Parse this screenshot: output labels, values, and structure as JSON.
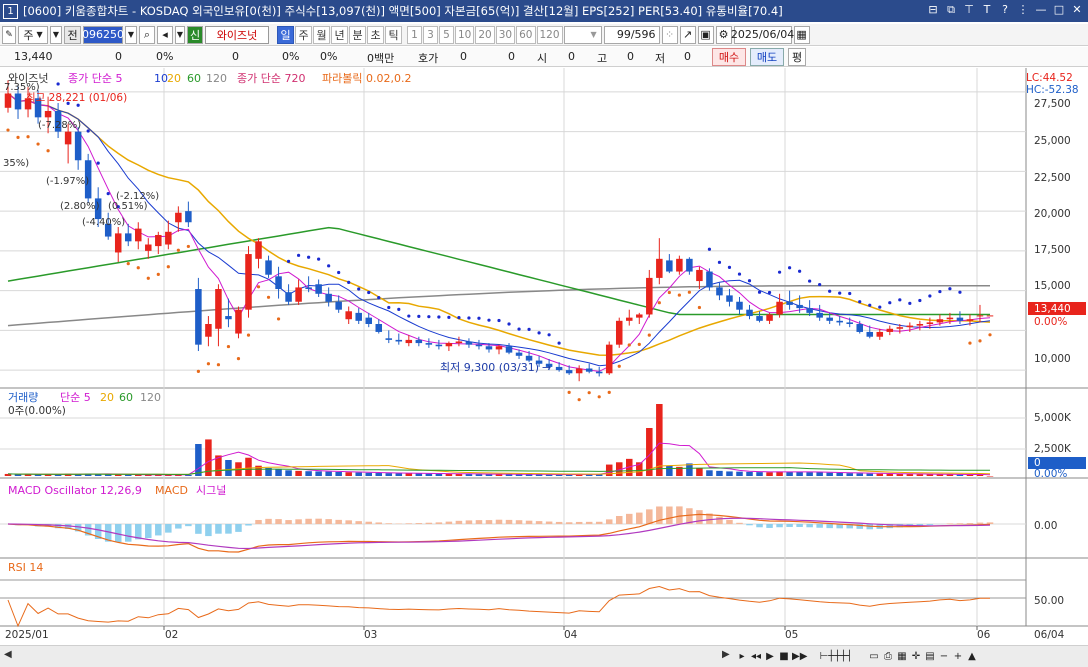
{
  "window": {
    "number": "1",
    "title": "[0600] 키움종합차트 - KOSDAQ 외국인보유[0(천)] 주식수[13,097(천)] 액면[500] 자본금[65(억)] 결산[12월] EPS[252] PER[53.40] 유통비율[70.4]"
  },
  "toolbar": {
    "market": "주",
    "all_label": "전",
    "code": "096250",
    "new_label": "신",
    "stock_name": "와이즈넛",
    "periods": [
      "일",
      "주",
      "월",
      "년",
      "분",
      "초",
      "틱"
    ],
    "active_period": "일",
    "intervals": [
      "1",
      "3",
      "5",
      "10",
      "20",
      "30",
      "60",
      "120"
    ],
    "count": "99/596",
    "date": "2025/06/04"
  },
  "quote": {
    "price": "13,440",
    "change": "0",
    "change_pct": "0%",
    "volume": "0",
    "volume_pct": "0%",
    "trade_amount": "0",
    "amount_pct": "0%",
    "amount_unit": "0백만",
    "bid_label": "호가",
    "bid": "0",
    "bid_qty": "0",
    "open_label": "시",
    "open": "0",
    "high_label": "고",
    "high": "0",
    "low_label": "저",
    "low": "0",
    "buy_label": "매수",
    "sell_label": "매도",
    "eval_label": "평"
  },
  "price_panel": {
    "legend_stock": "와이즈넛",
    "legend_ma": "종가 단순 5",
    "ma_periods": [
      "5",
      "10",
      "20",
      "60",
      "120"
    ],
    "legend_ma_long": "종가 단순 720",
    "legend_psar": "파라볼릭 0.02,0.2",
    "high_annotation": "최고 28,221 (01/06)",
    "low_annotation": "최저 9,300 (03/31)",
    "pct_labels": [
      "7.35%)",
      "(-7.28%)",
      "35%)",
      "(-1.97%)",
      "(-2.12%)",
      "(2.80%)",
      "(0.51%)",
      "(-4.40%)"
    ],
    "lc_label": "LC:44.52",
    "hc_label": "HC:-52.38",
    "y_ticks": [
      "27,500",
      "25,000",
      "22,500",
      "20,000",
      "17,500",
      "15,000",
      "10,000"
    ],
    "last_price": "13,440",
    "last_pct": "0.00%"
  },
  "volume_panel": {
    "legend": "거래량",
    "legend_ma": "단순 5",
    "ma_periods": [
      "5",
      "20",
      "60",
      "120"
    ],
    "info": "0주(0.00%)",
    "y_ticks": [
      "5,000K",
      "2,500K"
    ],
    "last": "0",
    "last_pct": "0.00%"
  },
  "macd_panel": {
    "legend": "MACD Oscillator 12,26,9",
    "legend_macd": "MACD",
    "legend_signal": "시그널",
    "y_tick": "0.00"
  },
  "rsi_panel": {
    "legend": "RSI 14",
    "y_tick": "50.00"
  },
  "x_axis": {
    "labels": [
      "2025/01",
      "02",
      "03",
      "04",
      "05",
      "06"
    ],
    "right_date": "06/04"
  },
  "colors": {
    "up": "#e8241c",
    "down": "#1e5ec8",
    "ma5": "#d01ad0",
    "ma10": "#1a3cd0",
    "ma20": "#e8a800",
    "ma60": "#2a9a2a",
    "ma120": "#888888",
    "psar_up": "#e86a1a",
    "psar_down": "#1a2ad0",
    "grid": "#d8d8d8",
    "panel_sep": "#888888"
  },
  "chart_data": {
    "type": "candlestick",
    "title": "",
    "x_labels": [
      "2025/01",
      "02",
      "03",
      "04",
      "05",
      "06"
    ],
    "price_ylim": [
      9000,
      28500
    ],
    "candles": [
      {
        "o": 26500,
        "h": 28221,
        "l": 26200,
        "c": 27400
      },
      {
        "o": 27400,
        "h": 27900,
        "l": 25800,
        "c": 26400
      },
      {
        "o": 26400,
        "h": 27800,
        "l": 25900,
        "c": 27100
      },
      {
        "o": 27100,
        "h": 27600,
        "l": 25500,
        "c": 25900
      },
      {
        "o": 25900,
        "h": 27200,
        "l": 24900,
        "c": 26300
      },
      {
        "o": 26300,
        "h": 26800,
        "l": 24600,
        "c": 25000
      },
      {
        "o": 24200,
        "h": 25500,
        "l": 23000,
        "c": 25000
      },
      {
        "o": 25000,
        "h": 25300,
        "l": 22600,
        "c": 23200
      },
      {
        "o": 23200,
        "h": 23600,
        "l": 20500,
        "c": 20800
      },
      {
        "o": 20800,
        "h": 21500,
        "l": 19000,
        "c": 19500
      },
      {
        "o": 19200,
        "h": 19900,
        "l": 18200,
        "c": 18400
      },
      {
        "o": 17400,
        "h": 19000,
        "l": 16800,
        "c": 18600
      },
      {
        "o": 18600,
        "h": 19200,
        "l": 17800,
        "c": 18100
      },
      {
        "o": 18100,
        "h": 19300,
        "l": 17600,
        "c": 18900
      },
      {
        "o": 17500,
        "h": 18300,
        "l": 17000,
        "c": 17900
      },
      {
        "o": 17800,
        "h": 18700,
        "l": 17300,
        "c": 18500
      },
      {
        "o": 17900,
        "h": 19400,
        "l": 17600,
        "c": 18700
      },
      {
        "o": 19300,
        "h": 20300,
        "l": 18700,
        "c": 19900
      },
      {
        "o": 20000,
        "h": 20600,
        "l": 19000,
        "c": 19300
      },
      {
        "o": 15100,
        "h": 15800,
        "l": 11200,
        "c": 11600
      },
      {
        "o": 12100,
        "h": 13400,
        "l": 11500,
        "c": 12900
      },
      {
        "o": 12600,
        "h": 15400,
        "l": 11500,
        "c": 15100
      },
      {
        "o": 13400,
        "h": 14500,
        "l": 12700,
        "c": 13200
      },
      {
        "o": 12300,
        "h": 14000,
        "l": 12000,
        "c": 13800
      },
      {
        "o": 13800,
        "h": 17800,
        "l": 13300,
        "c": 17300
      },
      {
        "o": 17000,
        "h": 18300,
        "l": 16400,
        "c": 18100
      },
      {
        "o": 16900,
        "h": 17200,
        "l": 15800,
        "c": 16000
      },
      {
        "o": 15900,
        "h": 16500,
        "l": 14500,
        "c": 15100
      },
      {
        "o": 14900,
        "h": 15400,
        "l": 14100,
        "c": 14300
      },
      {
        "o": 14300,
        "h": 15700,
        "l": 14100,
        "c": 15200
      },
      {
        "o": 15200,
        "h": 15900,
        "l": 14900,
        "c": 15100
      },
      {
        "o": 15400,
        "h": 15700,
        "l": 14600,
        "c": 14800
      },
      {
        "o": 14800,
        "h": 15200,
        "l": 14000,
        "c": 14300
      },
      {
        "o": 14300,
        "h": 14700,
        "l": 13600,
        "c": 13800
      },
      {
        "o": 13200,
        "h": 14000,
        "l": 12900,
        "c": 13700
      },
      {
        "o": 13600,
        "h": 13900,
        "l": 12900,
        "c": 13100
      },
      {
        "o": 13300,
        "h": 13600,
        "l": 12700,
        "c": 12900
      },
      {
        "o": 12900,
        "h": 13200,
        "l": 12300,
        "c": 12400
      },
      {
        "o": 12000,
        "h": 12500,
        "l": 11700,
        "c": 11900
      },
      {
        "o": 11900,
        "h": 12300,
        "l": 11600,
        "c": 11800
      },
      {
        "o": 11700,
        "h": 12200,
        "l": 11500,
        "c": 11900
      },
      {
        "o": 11900,
        "h": 12100,
        "l": 11500,
        "c": 11700
      },
      {
        "o": 11700,
        "h": 12000,
        "l": 11400,
        "c": 11600
      },
      {
        "o": 11600,
        "h": 11900,
        "l": 11300,
        "c": 11500
      },
      {
        "o": 11500,
        "h": 11800,
        "l": 11200,
        "c": 11700
      },
      {
        "o": 11700,
        "h": 12100,
        "l": 11500,
        "c": 11800
      },
      {
        "o": 11800,
        "h": 12000,
        "l": 11400,
        "c": 11600
      },
      {
        "o": 11600,
        "h": 11900,
        "l": 11300,
        "c": 11500
      },
      {
        "o": 11500,
        "h": 11700,
        "l": 11100,
        "c": 11300
      },
      {
        "o": 11300,
        "h": 11600,
        "l": 11000,
        "c": 11500
      },
      {
        "o": 11500,
        "h": 11700,
        "l": 11000,
        "c": 11100
      },
      {
        "o": 11100,
        "h": 11300,
        "l": 10700,
        "c": 10900
      },
      {
        "o": 10900,
        "h": 11200,
        "l": 10500,
        "c": 10600
      },
      {
        "o": 10600,
        "h": 10900,
        "l": 10200,
        "c": 10400
      },
      {
        "o": 10400,
        "h": 10700,
        "l": 10000,
        "c": 10200
      },
      {
        "o": 10200,
        "h": 10500,
        "l": 9900,
        "c": 10000
      },
      {
        "o": 10000,
        "h": 10300,
        "l": 9700,
        "c": 9800
      },
      {
        "o": 9800,
        "h": 10300,
        "l": 9300,
        "c": 10100
      },
      {
        "o": 10100,
        "h": 10400,
        "l": 9800,
        "c": 9900
      },
      {
        "o": 9900,
        "h": 10200,
        "l": 9600,
        "c": 9800
      },
      {
        "o": 9800,
        "h": 11800,
        "l": 9700,
        "c": 11600
      },
      {
        "o": 11600,
        "h": 13300,
        "l": 11400,
        "c": 13100
      },
      {
        "o": 13100,
        "h": 13800,
        "l": 12800,
        "c": 13300
      },
      {
        "o": 13300,
        "h": 13600,
        "l": 12900,
        "c": 13500
      },
      {
        "o": 13500,
        "h": 16300,
        "l": 13300,
        "c": 15800
      },
      {
        "o": 15800,
        "h": 18300,
        "l": 15400,
        "c": 17000
      },
      {
        "o": 16900,
        "h": 17300,
        "l": 16100,
        "c": 16200
      },
      {
        "o": 16200,
        "h": 17200,
        "l": 16000,
        "c": 17000
      },
      {
        "o": 17000,
        "h": 17100,
        "l": 16000,
        "c": 16200
      },
      {
        "o": 15600,
        "h": 16500,
        "l": 15100,
        "c": 16300
      },
      {
        "o": 16200,
        "h": 16400,
        "l": 15000,
        "c": 15200
      },
      {
        "o": 15200,
        "h": 15500,
        "l": 14400,
        "c": 14700
      },
      {
        "o": 14700,
        "h": 15100,
        "l": 14000,
        "c": 14300
      },
      {
        "o": 14300,
        "h": 14600,
        "l": 13500,
        "c": 13800
      },
      {
        "o": 13800,
        "h": 14100,
        "l": 13200,
        "c": 13400
      },
      {
        "o": 13400,
        "h": 13700,
        "l": 13000,
        "c": 13100
      },
      {
        "o": 13100,
        "h": 13600,
        "l": 12900,
        "c": 13500
      },
      {
        "o": 13500,
        "h": 14800,
        "l": 13300,
        "c": 14300
      },
      {
        "o": 14300,
        "h": 15000,
        "l": 13800,
        "c": 14100
      },
      {
        "o": 14100,
        "h": 14700,
        "l": 13600,
        "c": 13900
      },
      {
        "o": 13900,
        "h": 14400,
        "l": 13400,
        "c": 13600
      },
      {
        "o": 13600,
        "h": 14100,
        "l": 13100,
        "c": 13300
      },
      {
        "o": 13300,
        "h": 13600,
        "l": 12900,
        "c": 13100
      },
      {
        "o": 13100,
        "h": 13400,
        "l": 12800,
        "c": 13000
      },
      {
        "o": 13000,
        "h": 13300,
        "l": 12700,
        "c": 12900
      },
      {
        "o": 12900,
        "h": 13100,
        "l": 12300,
        "c": 12400
      },
      {
        "o": 12400,
        "h": 12800,
        "l": 12000,
        "c": 12100
      },
      {
        "o": 12100,
        "h": 12600,
        "l": 11900,
        "c": 12400
      },
      {
        "o": 12400,
        "h": 12800,
        "l": 12200,
        "c": 12600
      },
      {
        "o": 12600,
        "h": 12900,
        "l": 12300,
        "c": 12700
      },
      {
        "o": 12700,
        "h": 13000,
        "l": 12400,
        "c": 12800
      },
      {
        "o": 12800,
        "h": 13100,
        "l": 12500,
        "c": 12900
      },
      {
        "o": 12900,
        "h": 13300,
        "l": 12600,
        "c": 13000
      },
      {
        "o": 13000,
        "h": 13500,
        "l": 12800,
        "c": 13200
      },
      {
        "o": 13200,
        "h": 13600,
        "l": 12900,
        "c": 13300
      },
      {
        "o": 13300,
        "h": 13700,
        "l": 12900,
        "c": 13100
      },
      {
        "o": 13100,
        "h": 13500,
        "l": 12800,
        "c": 13200
      },
      {
        "o": 13400,
        "h": 14100,
        "l": 13000,
        "c": 13440
      },
      {
        "o": 13440,
        "h": 13440,
        "l": 13440,
        "c": 13440
      }
    ],
    "volume_k": [
      180,
      160,
      150,
      140,
      130,
      120,
      200,
      180,
      220,
      160,
      140,
      120,
      110,
      100,
      90,
      120,
      110,
      130,
      100,
      2800,
      3200,
      1800,
      1400,
      1200,
      1600,
      900,
      700,
      600,
      500,
      450,
      420,
      400,
      380,
      350,
      330,
      300,
      280,
      260,
      250,
      240,
      230,
      220,
      210,
      200,
      190,
      180,
      170,
      160,
      150,
      160,
      170,
      150,
      140,
      130,
      120,
      110,
      140,
      160,
      150,
      140,
      1000,
      1200,
      1500,
      1200,
      4200,
      6300,
      900,
      800,
      1100,
      700,
      500,
      450,
      400,
      380,
      360,
      340,
      320,
      400,
      380,
      350,
      330,
      310,
      290,
      270,
      250,
      230,
      210,
      200,
      190,
      180,
      170,
      160,
      150,
      140,
      130,
      120,
      110,
      220,
      0
    ],
    "ma120_price": [
      12800,
      15300
    ],
    "ma60_price": [
      15600,
      19000,
      13500
    ],
    "rsi_level": 50
  }
}
